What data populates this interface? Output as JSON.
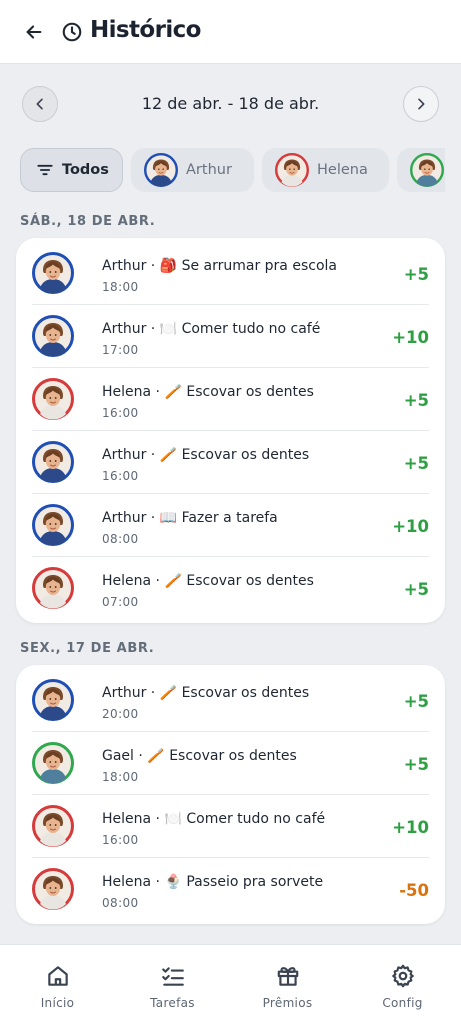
{
  "header": {
    "title": "Histórico",
    "back_icon": "arrow-left-icon",
    "title_icon": "clock-icon"
  },
  "week": {
    "label": "12 de abr. - 18 de abr.",
    "prev_icon": "chevron-left-icon",
    "next_icon": "chevron-right-icon"
  },
  "filters": {
    "all_label": "Todos",
    "people": [
      {
        "name": "Arthur",
        "ring": "#1f4fb5",
        "shirt": "#2c4a8a"
      },
      {
        "name": "Helena",
        "ring": "#d63a3a",
        "shirt": "#e9e6e2"
      },
      {
        "name": "",
        "ring": "#2fa84f",
        "shirt": "#4f7f9c"
      }
    ]
  },
  "days": [
    {
      "header": "SÁB., 18 DE ABR.",
      "entries": [
        {
          "person": "Arthur",
          "emoji": "🎒",
          "task": "Se arrumar pra escola",
          "time": "18:00",
          "points": "+5",
          "negative": false
        },
        {
          "person": "Arthur",
          "emoji": "🍽️",
          "task": "Comer tudo no café",
          "time": "17:00",
          "points": "+10",
          "negative": false
        },
        {
          "person": "Helena",
          "emoji": "🪥",
          "task": "Escovar os dentes",
          "time": "16:00",
          "points": "+5",
          "negative": false
        },
        {
          "person": "Arthur",
          "emoji": "🪥",
          "task": "Escovar os dentes",
          "time": "16:00",
          "points": "+5",
          "negative": false
        },
        {
          "person": "Arthur",
          "emoji": "📖",
          "task": "Fazer a tarefa",
          "time": "08:00",
          "points": "+10",
          "negative": false
        },
        {
          "person": "Helena",
          "emoji": "🪥",
          "task": "Escovar os dentes",
          "time": "07:00",
          "points": "+5",
          "negative": false
        }
      ]
    },
    {
      "header": "SEX., 17 DE ABR.",
      "entries": [
        {
          "person": "Arthur",
          "emoji": "🪥",
          "task": "Escovar os dentes",
          "time": "20:00",
          "points": "+5",
          "negative": false
        },
        {
          "person": "Gael",
          "emoji": "🪥",
          "task": "Escovar os dentes",
          "time": "18:00",
          "points": "+5",
          "negative": false
        },
        {
          "person": "Helena",
          "emoji": "🍽️",
          "task": "Comer tudo no café",
          "time": "16:00",
          "points": "+10",
          "negative": false
        },
        {
          "person": "Helena",
          "emoji": "🍨",
          "task": "Passeio pra sorvete",
          "time": "08:00",
          "points": "-50",
          "negative": true
        }
      ]
    }
  ],
  "nav": [
    {
      "label": "Início",
      "icon": "home-icon"
    },
    {
      "label": "Tarefas",
      "icon": "checklist-icon"
    },
    {
      "label": "Prêmios",
      "icon": "gift-icon"
    },
    {
      "label": "Config",
      "icon": "gear-icon"
    }
  ],
  "colors": {
    "positive": "#2ea043",
    "negative": "#d9730d",
    "background": "#eceef1",
    "arthur": "#1f4fb5",
    "helena": "#d63a3a",
    "gael": "#2fa84f"
  }
}
